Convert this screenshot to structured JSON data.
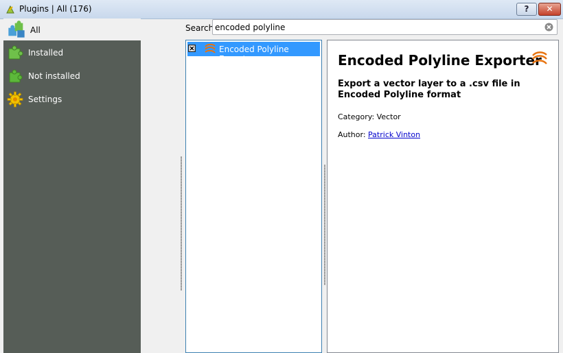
{
  "window": {
    "title": "Plugins | All (176)",
    "help_label": "?",
    "close_label": "✕"
  },
  "sidebar": {
    "items": [
      {
        "label": "All",
        "icon": "plugins-all-icon"
      },
      {
        "label": "Installed",
        "icon": "puzzle-installed-icon"
      },
      {
        "label": "Not installed",
        "icon": "puzzle-not-installed-icon"
      },
      {
        "label": "Settings",
        "icon": "gear-icon"
      }
    ]
  },
  "search": {
    "label": "Search",
    "value": "encoded polyline",
    "placeholder": ""
  },
  "plugins": [
    {
      "name": "Encoded Polyline Exporter",
      "checked": true,
      "selected": true
    }
  ],
  "details": {
    "name": "Encoded Polyline Exporter",
    "description": "Export a vector layer to a .csv file in Encoded Polyline format",
    "category_label": "Category:",
    "category": "Vector",
    "author_label": "Author:",
    "author": "Patrick Vinton"
  },
  "colors": {
    "sidebar_bg": "#565d57",
    "selection": "#3399ff",
    "link": "#0000cc"
  }
}
